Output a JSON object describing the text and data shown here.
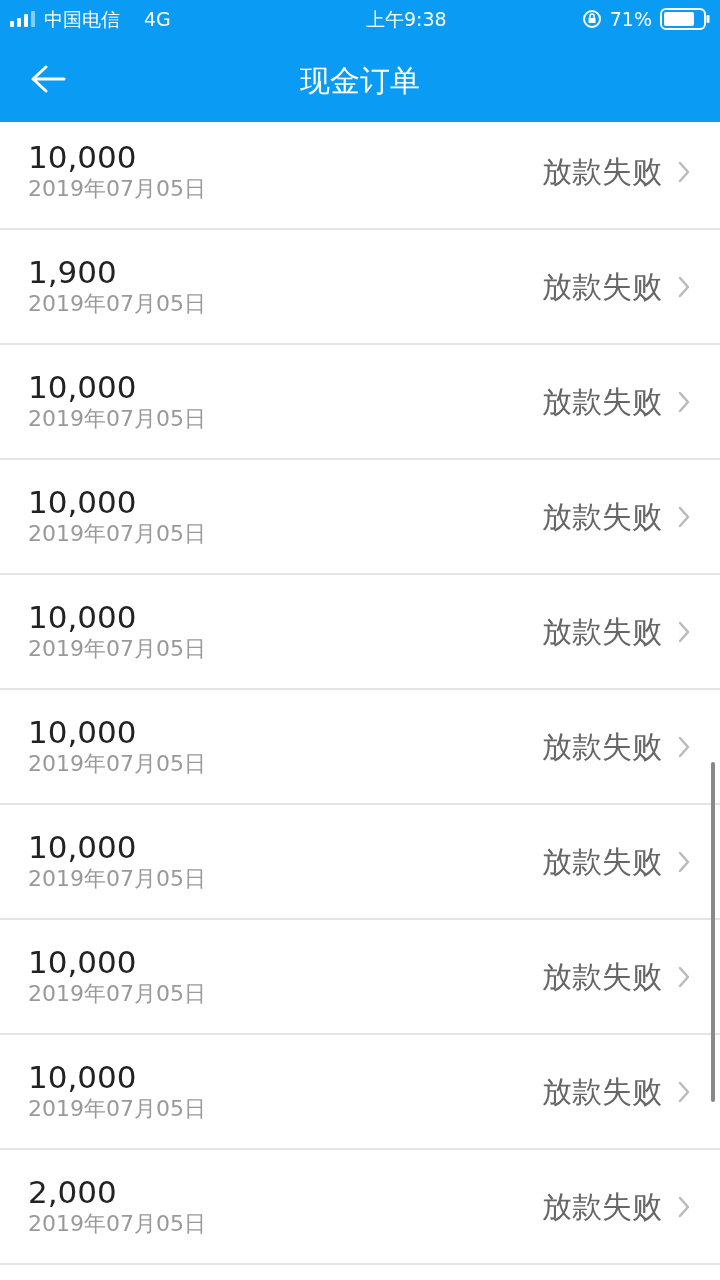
{
  "status_bar": {
    "carrier": "中国电信",
    "network": "4G",
    "time": "上午9:38",
    "battery": "71%"
  },
  "header": {
    "title": "现金订单"
  },
  "orders": [
    {
      "amount": "10,000",
      "date": "2019年07月05日",
      "status": "放款失败"
    },
    {
      "amount": "1,900",
      "date": "2019年07月05日",
      "status": "放款失败"
    },
    {
      "amount": "10,000",
      "date": "2019年07月05日",
      "status": "放款失败"
    },
    {
      "amount": "10,000",
      "date": "2019年07月05日",
      "status": "放款失败"
    },
    {
      "amount": "10,000",
      "date": "2019年07月05日",
      "status": "放款失败"
    },
    {
      "amount": "10,000",
      "date": "2019年07月05日",
      "status": "放款失败"
    },
    {
      "amount": "10,000",
      "date": "2019年07月05日",
      "status": "放款失败"
    },
    {
      "amount": "10,000",
      "date": "2019年07月05日",
      "status": "放款失败"
    },
    {
      "amount": "10,000",
      "date": "2019年07月05日",
      "status": "放款失败"
    },
    {
      "amount": "2,000",
      "date": "2019年07月05日",
      "status": "放款失败"
    }
  ]
}
